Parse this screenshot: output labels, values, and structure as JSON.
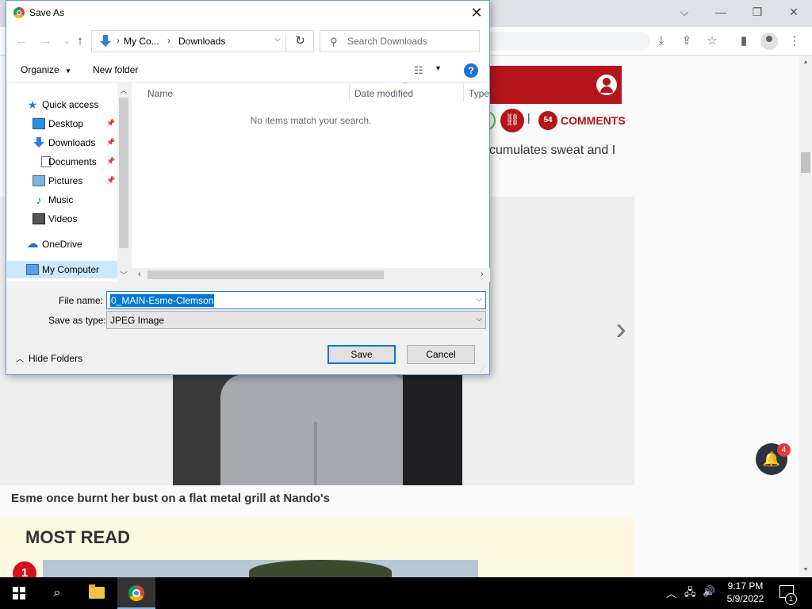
{
  "dialog": {
    "title": "Save As",
    "close_label": "✕",
    "nav": {
      "back": "←",
      "forward": "→",
      "recent": "⌄",
      "up": "↑"
    },
    "breadcrumb": [
      "My Co...",
      "Downloads"
    ],
    "search_placeholder": "Search Downloads",
    "toolbar": {
      "organize": "Organize",
      "new_folder": "New folder",
      "help": "?"
    },
    "nav_pane": {
      "items": [
        {
          "label": "Quick access",
          "icon": "star-icon"
        },
        {
          "label": "Desktop",
          "icon": "desktop-icon",
          "pinned": true
        },
        {
          "label": "Downloads",
          "icon": "download-icon",
          "pinned": true
        },
        {
          "label": "Documents",
          "icon": "document-icon",
          "pinned": true
        },
        {
          "label": "Pictures",
          "icon": "pictures-icon",
          "pinned": true
        },
        {
          "label": "Music",
          "icon": "music-icon"
        },
        {
          "label": "Videos",
          "icon": "video-icon"
        },
        {
          "label": "OneDrive",
          "icon": "cloud-icon"
        },
        {
          "label": "My Computer",
          "icon": "computer-icon",
          "selected": true
        }
      ]
    },
    "columns": [
      "Name",
      "Date modified",
      "Type"
    ],
    "empty_message": "No items match your search.",
    "file_name_label": "File name:",
    "file_name_value": "0_MAIN-Esme-Clemson",
    "save_as_type_label": "Save as type:",
    "save_as_type_value": "JPEG Image",
    "hide_folders": "Hide Folders",
    "save_button": "Save",
    "cancel_button": "Cancel"
  },
  "browser": {
    "comment_count": "54",
    "comments_label": "COMMENTS",
    "article_snippet": "cumulates sweat and I",
    "caption": "Esme once burnt her bust on a flat metal grill at Nando's",
    "most_read_title": "MOST READ",
    "most_read_rank": "1",
    "notification_count": "4",
    "accent_color": "#b3151a"
  },
  "taskbar": {
    "time": "9:17 PM",
    "date": "5/9/2022",
    "notification_badge": "1"
  }
}
